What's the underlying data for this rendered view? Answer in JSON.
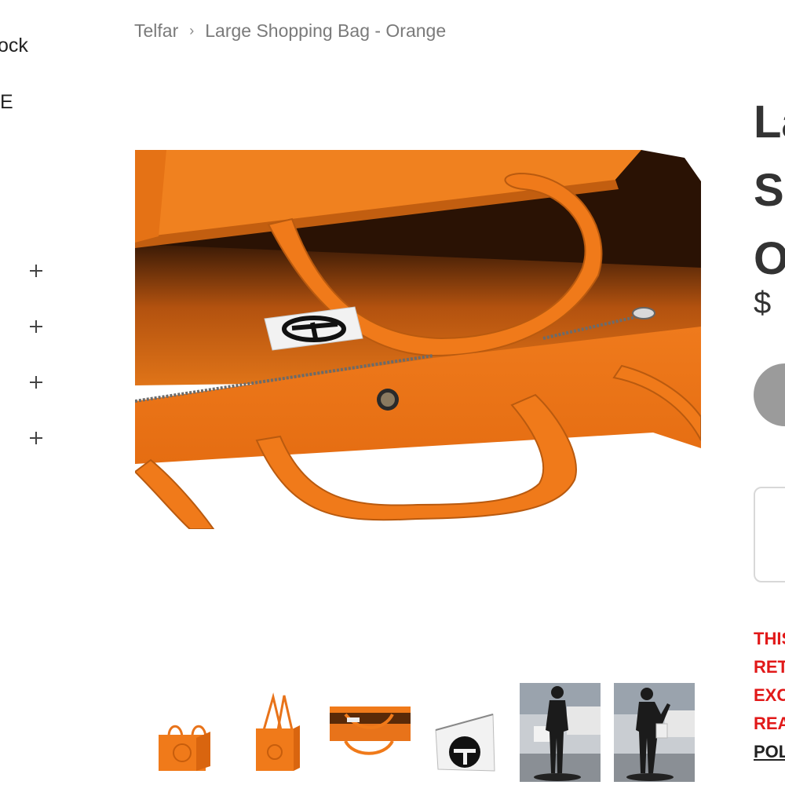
{
  "sidebar": {
    "stock_fragment": "ock",
    "e_fragment": "E",
    "filters": [
      {
        "icon": "plus-icon"
      },
      {
        "icon": "plus-icon"
      },
      {
        "icon": "plus-icon"
      },
      {
        "icon": "plus-icon"
      }
    ]
  },
  "breadcrumb": {
    "home": "Telfar",
    "separator": "›",
    "current": "Large Shopping Bag - Orange"
  },
  "product": {
    "title_fragment": "La\nS\nO",
    "price_fragment": "$ ",
    "notice": {
      "line1": "THIS",
      "line2": "RET",
      "line3": "EXC",
      "line4": "REA",
      "policy_fragment": "POL"
    }
  },
  "thumbnails": [
    {
      "alt_icon": "orange-bag-front-thumbnail"
    },
    {
      "alt_icon": "orange-bag-side-thumbnail"
    },
    {
      "alt_icon": "orange-bag-interior-thumbnail"
    },
    {
      "alt_icon": "white-dustbag-logo-thumbnail"
    },
    {
      "alt_icon": "mannequin-street-thumbnail"
    },
    {
      "alt_icon": "mannequin-street-bag-thumbnail"
    }
  ],
  "colors": {
    "brand_orange": "#f07a1a",
    "notice_red": "#e11919",
    "button_gray": "#9b9b9b"
  }
}
